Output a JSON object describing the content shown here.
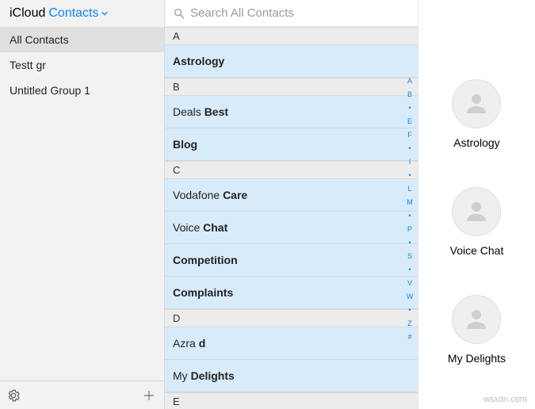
{
  "header": {
    "brand": "iCloud",
    "app": "Contacts"
  },
  "sidebar": {
    "items": [
      {
        "label": "All Contacts",
        "selected": true
      },
      {
        "label": "Testt gr",
        "selected": false
      },
      {
        "label": "Untitled Group 1",
        "selected": false
      }
    ]
  },
  "search": {
    "placeholder": "Search All Contacts"
  },
  "sections": [
    {
      "letter": "A",
      "rows": [
        {
          "pre": "",
          "bold": "Astrology",
          "post": ""
        }
      ]
    },
    {
      "letter": "B",
      "rows": [
        {
          "pre": "Deals ",
          "bold": "Best",
          "post": ""
        },
        {
          "pre": "",
          "bold": "Blog",
          "post": ""
        }
      ]
    },
    {
      "letter": "C",
      "rows": [
        {
          "pre": "Vodafone ",
          "bold": "Care",
          "post": ""
        },
        {
          "pre": "Voice ",
          "bold": "Chat",
          "post": ""
        },
        {
          "pre": "",
          "bold": "Competition",
          "post": ""
        },
        {
          "pre": "",
          "bold": "Complaints",
          "post": ""
        }
      ]
    },
    {
      "letter": "D",
      "rows": [
        {
          "pre": "Azra ",
          "bold": "d",
          "post": ""
        },
        {
          "pre": "My ",
          "bold": "Delights",
          "post": ""
        }
      ]
    },
    {
      "letter": "E",
      "rows": []
    }
  ],
  "indexRail": [
    "A",
    "B",
    "•",
    "E",
    "F",
    "•",
    "I",
    "•",
    "L",
    "M",
    "•",
    "P",
    "•",
    "S",
    "•",
    "V",
    "W",
    "•",
    "Z",
    "#"
  ],
  "detail": {
    "cards": [
      {
        "label": "Astrology"
      },
      {
        "label": "Voice Chat"
      },
      {
        "label": "My Delights"
      }
    ]
  },
  "watermark": "wsxdn.com"
}
